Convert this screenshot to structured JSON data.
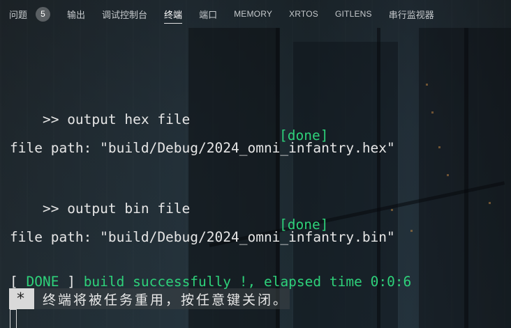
{
  "panel": {
    "tabs": [
      {
        "label": "问题",
        "badge": "5"
      },
      {
        "label": "输出"
      },
      {
        "label": "调试控制台"
      },
      {
        "label": "终端"
      },
      {
        "label": "端口"
      },
      {
        "label": "MEMORY"
      },
      {
        "label": "XRTOS"
      },
      {
        "label": "GITLENS"
      },
      {
        "label": "串行监视器"
      }
    ],
    "active_tab": "终端"
  },
  "terminal": {
    "line1_text": ">> output hex file",
    "line1_status": "[done]",
    "line2_text": "file path: \"build/Debug/2024_omni_infantry.hex\"",
    "line3_text": ">> output bin file",
    "line3_status": "[done]",
    "line4_text": "file path: \"build/Debug/2024_omni_infantry.bin\"",
    "line5_open": "[ ",
    "line5_done": "DONE",
    "line5_close": " ] ",
    "line5_message": "build successfully !, elapsed time 0:0:6",
    "notice_marker": "*",
    "notice_text": "终端将被任务重用，按任意键关闭。"
  },
  "colors": {
    "success": "#2ed17a",
    "text": "#e6e6e6"
  }
}
